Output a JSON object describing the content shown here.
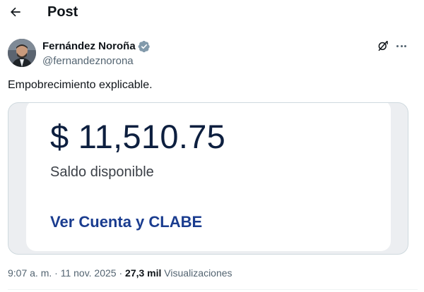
{
  "header": {
    "back_icon": "arrow-left-icon",
    "title": "Post"
  },
  "author": {
    "name": "Fernández Noroña",
    "handle": "@fernandeznorona",
    "verified_icon": "verified-badge-icon",
    "verified_color": "#1d9bf0"
  },
  "actions": {
    "grok_icon": "grok-icon",
    "more_icon": "more-horizontal-icon"
  },
  "tweet": {
    "text": "Empobrecimiento explicable."
  },
  "media": {
    "amount": "$ 11,510.75",
    "balance_label": "Saldo disponible",
    "link_label": "Ver Cuenta y CLABE",
    "link_color": "#1a3c8f"
  },
  "meta": {
    "datetime": "9:07 a. m. · 11 nov. 2025 · ",
    "views_count": "27,3 mil",
    "views_label": " Visualizaciones"
  }
}
